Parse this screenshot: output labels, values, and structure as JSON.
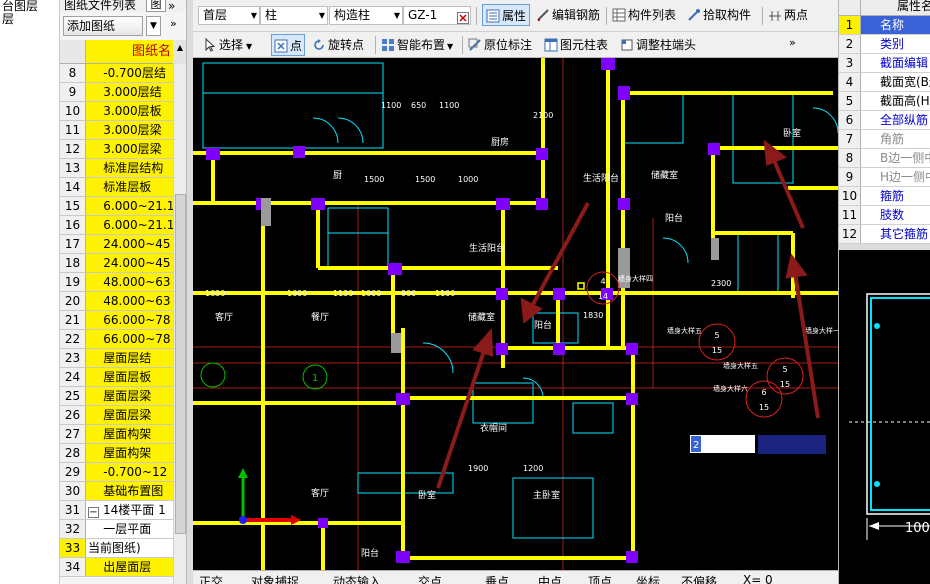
{
  "left_stub": {
    "line1": "台图层",
    "line2": "层"
  },
  "file_panel": {
    "tab_label": "图纸文件列表",
    "tab_more": "»",
    "add_button": "添加图纸",
    "header_name": "图纸名",
    "rows": [
      {
        "no": "8",
        "name": "    -0.700层结"
      },
      {
        "no": "9",
        "name": "    3.000层结"
      },
      {
        "no": "10",
        "name": "    3.000层板"
      },
      {
        "no": "11",
        "name": "    3.000层梁"
      },
      {
        "no": "12",
        "name": "    3.000层梁"
      },
      {
        "no": "13",
        "name": "    标准层结构"
      },
      {
        "no": "14",
        "name": "    标准层板"
      },
      {
        "no": "15",
        "name": "    6.000~21.1"
      },
      {
        "no": "16",
        "name": "    6.000~21.1"
      },
      {
        "no": "17",
        "name": "    24.000~45"
      },
      {
        "no": "18",
        "name": "    24.000~45"
      },
      {
        "no": "19",
        "name": "    48.000~63"
      },
      {
        "no": "20",
        "name": "    48.000~63"
      },
      {
        "no": "21",
        "name": "    66.000~78"
      },
      {
        "no": "22",
        "name": "    66.000~78"
      },
      {
        "no": "23",
        "name": "    屋面层结"
      },
      {
        "no": "24",
        "name": "    屋面层板"
      },
      {
        "no": "25",
        "name": "    屋面层梁"
      },
      {
        "no": "26",
        "name": "    屋面层梁"
      },
      {
        "no": "27",
        "name": "    屋面构架"
      },
      {
        "no": "28",
        "name": "    屋面构架"
      },
      {
        "no": "29",
        "name": "    -0.700~12"
      },
      {
        "no": "30",
        "name": "    基础布置图"
      },
      {
        "no": "31",
        "name": "14楼平面 1",
        "expander": "−"
      },
      {
        "no": "32",
        "name": "    一层平面"
      },
      {
        "no": "33",
        "name": "当前图纸)"
      },
      {
        "no": "34",
        "name": "    出屋面层"
      }
    ]
  },
  "toolbar1": {
    "floor_select": "首层",
    "type_select": "柱",
    "subtype_select": "构造柱",
    "name_select": "GZ-1",
    "props_button": "属性",
    "edit_rebar_button": "编辑钢筋",
    "component_list_button": "构件列表",
    "pick_component_button": "拾取构件",
    "two_points_button": "两点"
  },
  "toolbar2": {
    "select_button": "选择",
    "point_button": "点",
    "rotate_point_button": "旋转点",
    "smart_layout_button": "智能布置",
    "origin_mark_button": "原位标注",
    "column_table_button": "图元柱表",
    "adjust_column_button": "调整柱端头",
    "more": "»"
  },
  "status_bar": {
    "ortho": "正交",
    "snap": "对象捕捉",
    "dynamic_input": "动态输入",
    "intersection": "交点",
    "perpendicular": "垂点",
    "midpoint": "中点",
    "vertex": "顶点",
    "coordinate": "坐标",
    "no_offset": "不偏移",
    "x_label": "X=",
    "x_value": "0"
  },
  "props_panel": {
    "header": "属性名",
    "rows": [
      {
        "no": "1",
        "name": "名称",
        "style": "sel"
      },
      {
        "no": "2",
        "name": "类别",
        "style": "blue"
      },
      {
        "no": "3",
        "name": "截面编辑",
        "style": "blue"
      },
      {
        "no": "4",
        "name": "截面宽(B边",
        "style": "black"
      },
      {
        "no": "5",
        "name": "截面高(H边",
        "style": "black"
      },
      {
        "no": "6",
        "name": "全部纵筋",
        "style": "blue"
      },
      {
        "no": "7",
        "name": "角筋",
        "style": "gray"
      },
      {
        "no": "8",
        "name": "B边一侧中",
        "style": "gray"
      },
      {
        "no": "9",
        "name": "H边一侧中",
        "style": "gray"
      },
      {
        "no": "10",
        "name": "箍筋",
        "style": "blue"
      },
      {
        "no": "11",
        "name": "肢数",
        "style": "blue"
      },
      {
        "no": "12",
        "name": "其它箍筋",
        "style": "blue"
      }
    ]
  },
  "cad": {
    "room_labels": [
      "生活阳台",
      "储藏室",
      "阳台",
      "卧室",
      "餐厅",
      "客厅",
      "生活阳台",
      "储藏室",
      "阳台",
      "厨",
      "衣帽间",
      "主卧室",
      "卧室",
      "客厅",
      "阳台",
      "厨房"
    ],
    "dims": [
      "1100",
      "650",
      "1100",
      "1500",
      "1500",
      "1000",
      "1630",
      "1600",
      "1130",
      "1000",
      "900",
      "1100",
      "2300",
      "1900",
      "1200",
      "2100",
      "1830"
    ],
    "wall_notes": [
      "墙身大样四",
      "墙身大样五",
      "墙身大样五",
      "墙身大样六",
      "墙身大样一"
    ],
    "markers": [
      [
        "4",
        "14"
      ],
      [
        "5",
        "15"
      ],
      [
        "5",
        "15"
      ],
      [
        "6",
        "15"
      ]
    ],
    "cursor_box": "2",
    "axis_number": "1"
  },
  "preview": {
    "dim_label": "100"
  },
  "colors": {
    "wall": "#ffff00",
    "column": "#8000ff",
    "cyan": "#00e5ff",
    "accent_red": "#8b1a1a",
    "select": "#3a62d6"
  }
}
